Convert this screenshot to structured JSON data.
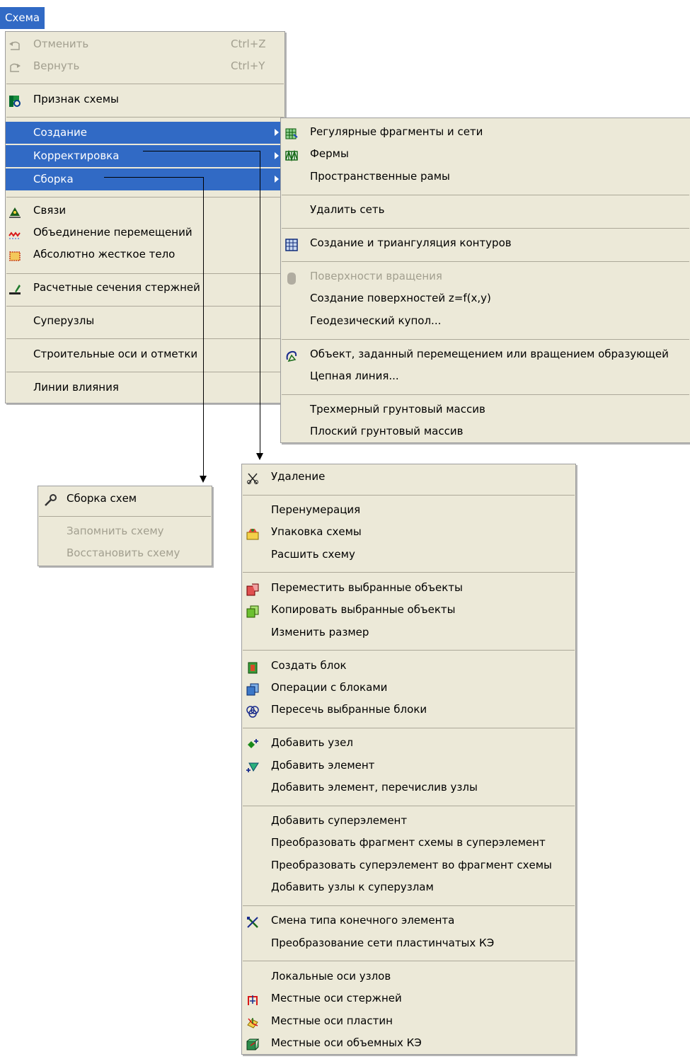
{
  "menubar": {
    "title": "Схема"
  },
  "main_menu": {
    "items": [
      {
        "label": "Отменить",
        "shortcut": "Ctrl+Z",
        "icon": "undo-icon",
        "disabled": true
      },
      {
        "label": "Вернуть",
        "shortcut": "Ctrl+Y",
        "icon": "redo-icon",
        "disabled": true
      },
      {
        "label": "Признак схемы",
        "icon": "scheme-flag-icon"
      },
      {
        "label": "Создание",
        "submenu": true,
        "selected": true
      },
      {
        "label": "Корректировка",
        "submenu": true,
        "selected": true
      },
      {
        "label": "Сборка",
        "submenu": true,
        "selected": true
      },
      {
        "label": "Связи",
        "icon": "constraint-icon"
      },
      {
        "label": "Объединение перемещений",
        "icon": "unite-displacements-icon"
      },
      {
        "label": "Абсолютно жесткое тело",
        "icon": "rigid-body-icon"
      },
      {
        "label": "Расчетные сечения стержней",
        "icon": "bar-sections-icon"
      },
      {
        "label": "Суперузлы"
      },
      {
        "label": "Строительные оси и отметки"
      },
      {
        "label": "Линии влияния"
      }
    ]
  },
  "creation_menu": {
    "items": [
      {
        "label": "Регулярные фрагменты и сети",
        "icon": "regular-grid-icon"
      },
      {
        "label": "Фермы",
        "icon": "truss-icon"
      },
      {
        "label": "Пространственные рамы"
      },
      {
        "label": "Удалить сеть"
      },
      {
        "label": "Создание и триангуляция контуров",
        "icon": "contour-triangulation-icon"
      },
      {
        "label": "Поверхности вращения",
        "icon": "rotation-surface-icon",
        "disabled": true
      },
      {
        "label": "Создание поверхностей z=f(x,y)"
      },
      {
        "label": "Геодезический купол..."
      },
      {
        "label": "Объект, заданный перемещением или вращением образующей",
        "icon": "sweep-object-icon"
      },
      {
        "label": "Цепная линия..."
      },
      {
        "label": "Трехмерный грунтовый массив"
      },
      {
        "label": "Плоский грунтовый массив"
      }
    ]
  },
  "assembly_menu": {
    "items": [
      {
        "label": "Сборка схем",
        "icon": "wrench-icon"
      },
      {
        "label": "Запомнить схему",
        "disabled": true
      },
      {
        "label": "Восстановить схему",
        "disabled": true
      }
    ]
  },
  "correction_menu": {
    "items": [
      {
        "label": "Удаление",
        "icon": "scissors-icon"
      },
      {
        "label": "Перенумерация"
      },
      {
        "label": "Упаковка схемы",
        "icon": "pack-scheme-icon"
      },
      {
        "label": "Расшить схему"
      },
      {
        "label": "Переместить выбранные объекты",
        "icon": "move-objects-icon"
      },
      {
        "label": "Копировать выбранные объекты",
        "icon": "copy-objects-icon"
      },
      {
        "label": "Изменить размер"
      },
      {
        "label": "Создать блок",
        "icon": "create-block-icon"
      },
      {
        "label": "Операции с блоками",
        "icon": "block-operations-icon"
      },
      {
        "label": "Пересечь выбранные блоки",
        "icon": "intersect-blocks-icon"
      },
      {
        "label": "Добавить  узел",
        "icon": "add-node-icon"
      },
      {
        "label": "Добавить элемент",
        "icon": "add-element-icon"
      },
      {
        "label": "Добавить элемент, перечислив узлы"
      },
      {
        "label": "Добавить суперэлемент"
      },
      {
        "label": "Преобразовать фрагмент схемы в суперэлемент"
      },
      {
        "label": "Преобразовать суперэлемент во фрагмент схемы"
      },
      {
        "label": "Добавить узлы к суперузлам"
      },
      {
        "label": "Смена типа конечного элемента",
        "icon": "change-fe-type-icon"
      },
      {
        "label": "Преобразование сети пластинчатых КЭ"
      },
      {
        "label": "Локальные оси узлов"
      },
      {
        "label": "Местные оси стержней",
        "icon": "bar-local-axes-icon"
      },
      {
        "label": "Местные оси пластин",
        "icon": "plate-local-axes-icon"
      },
      {
        "label": "Местные оси объемных КЭ",
        "icon": "solid-local-axes-icon"
      }
    ]
  },
  "colors": {
    "selection": "#316ac5",
    "menu_bg": "#ece9d8",
    "disabled_text": "#a29f8f"
  }
}
